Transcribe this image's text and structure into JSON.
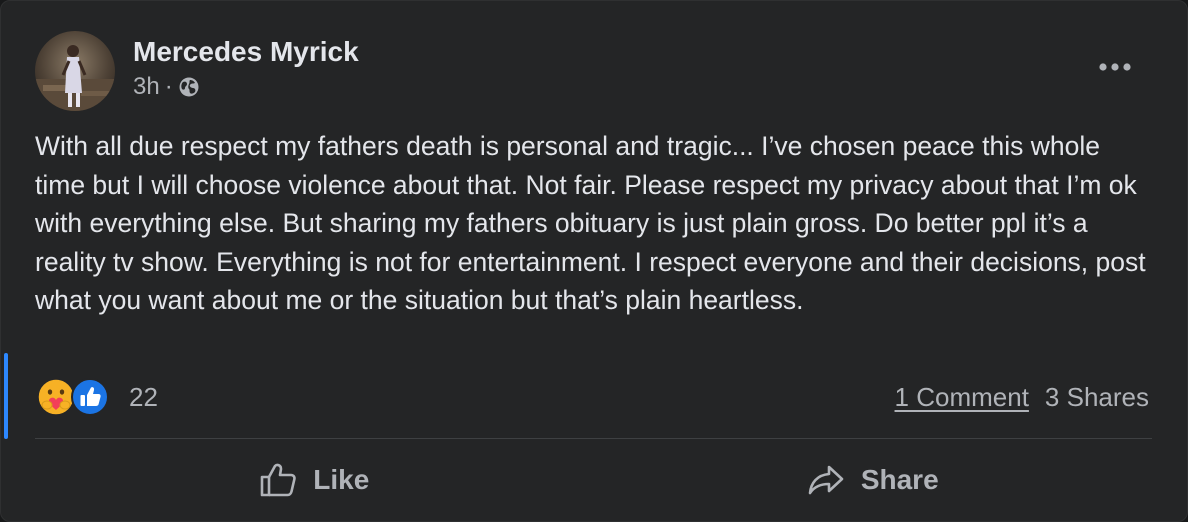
{
  "post": {
    "author": "Mercedes Myrick",
    "time": "3h",
    "separator": "·",
    "audience_icon": "globe-icon",
    "menu_icon": "more-options-icon",
    "text": "With all due respect my fathers death is personal and tragic... I’ve chosen peace this whole time but I will choose violence about that. Not fair. Please respect my privacy about that I’m ok with everything else. But sharing my fathers obituary is just plain gross. Do better ppl it’s a reality tv show. Everything is not for entertainment. I respect everyone and their decisions, post what you want about me or the situation but that’s plain heartless."
  },
  "reactions": {
    "icons": [
      "care-icon",
      "like-icon"
    ],
    "count": "22"
  },
  "engagement": {
    "comments": "1 Comment",
    "shares": "3 Shares"
  },
  "actions": {
    "like_label": "Like",
    "like_icon": "thumbs-up-icon",
    "share_label": "Share",
    "share_icon": "share-arrow-icon"
  },
  "colors": {
    "card_background": "#242526",
    "primary_text": "#e4e6eb",
    "secondary_text": "#b0b3b8",
    "accent_blue": "#2d88ff",
    "divider": "#3e4042"
  }
}
